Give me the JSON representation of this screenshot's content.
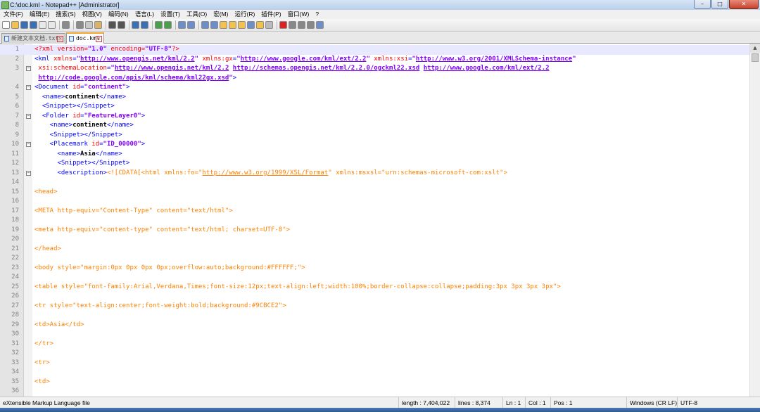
{
  "window": {
    "title": "C:\\doc.kml - Notepad++ [Administrator]",
    "min": "–",
    "max": "□",
    "close": "✕"
  },
  "menu": [
    "文件(F)",
    "编辑(E)",
    "搜索(S)",
    "视图(V)",
    "编码(N)",
    "语言(L)",
    "设置(T)",
    "工具(O)",
    "宏(M)",
    "运行(R)",
    "插件(P)",
    "窗口(W)",
    "?"
  ],
  "toolbar_icons": [
    "new-file-icon",
    "open-file-icon",
    "save-icon",
    "save-all-icon",
    "close-icon",
    "close-all-icon",
    "print-icon",
    "cut-icon",
    "copy-icon",
    "paste-icon",
    "undo-icon",
    "redo-icon",
    "find-icon",
    "replace-icon",
    "zoom-in-icon",
    "zoom-out-icon",
    "sync-vertical-icon",
    "sync-horizontal-icon",
    "word-wrap-icon",
    "show-all-chars-icon",
    "indent-guide-icon",
    "user-lang-icon",
    "doc-map-icon",
    "function-list-icon",
    "folder-workspace-icon",
    "monitoring-icon",
    "record-macro-icon",
    "stop-macro-icon",
    "play-macro-icon",
    "run-macro-icon",
    "save-macro-icon"
  ],
  "tabs": [
    {
      "label": "新建文本文档.txt",
      "active": false
    },
    {
      "label": "doc.kml",
      "active": true
    }
  ],
  "colors": {
    "tag": "#0000ff",
    "attr": "#ff0000",
    "string": "#8000ff",
    "cdata": "#ff8000",
    "accent": "#f3a52d"
  },
  "editor_lines": [
    {
      "n": "1",
      "fold": "",
      "tokens": [
        [
          "t-pi",
          "<?xml "
        ],
        [
          "t-attr",
          "version"
        ],
        [
          "t-pi",
          "="
        ],
        [
          "t-str",
          "\"1.0\""
        ],
        [
          "t-pi",
          " "
        ],
        [
          "t-attr",
          "encoding"
        ],
        [
          "t-pi",
          "="
        ],
        [
          "t-str",
          "\"UTF-8\""
        ],
        [
          "t-pi",
          "?>"
        ]
      ],
      "current": true
    },
    {
      "n": "2",
      "fold": "",
      "tokens": [
        [
          "t-tag",
          "<kml "
        ],
        [
          "t-attr",
          "xmlns"
        ],
        [
          "t-tag",
          "="
        ],
        [
          "t-str",
          "\""
        ],
        [
          "t-url",
          "http://www.opengis.net/kml/2.2"
        ],
        [
          "t-str",
          "\""
        ],
        [
          "t-tag",
          " "
        ],
        [
          "t-attr",
          "xmlns:gx"
        ],
        [
          "t-tag",
          "="
        ],
        [
          "t-str",
          "\""
        ],
        [
          "t-url",
          "http://www.google.com/kml/ext/2.2"
        ],
        [
          "t-str",
          "\""
        ],
        [
          "t-tag",
          " "
        ],
        [
          "t-attr",
          "xmlns:xsi"
        ],
        [
          "t-tag",
          "="
        ],
        [
          "t-str",
          "\""
        ],
        [
          "t-url",
          "http://www.w3.org/2001/XMLSchema-instance"
        ],
        [
          "t-str",
          "\""
        ]
      ]
    },
    {
      "n": "3",
      "fold": "−",
      "tokens": [
        [
          "t-tag",
          " "
        ],
        [
          "t-attr",
          "xsi:schemaLocation"
        ],
        [
          "t-tag",
          "="
        ],
        [
          "t-str",
          "\""
        ],
        [
          "t-url",
          "http://www.opengis.net/kml/2.2"
        ],
        [
          "t-str",
          " "
        ],
        [
          "t-url",
          "http://schemas.opengis.net/kml/2.2.0/ogckml22.xsd"
        ],
        [
          "t-str",
          " "
        ],
        [
          "t-url",
          "http://www.google.com/kml/ext/2.2"
        ]
      ]
    },
    {
      "n": "",
      "fold": "",
      "tokens": [
        [
          "t-str",
          " "
        ],
        [
          "t-url",
          "http://code.google.com/apis/kml/schema/kml22gx.xsd"
        ],
        [
          "t-str",
          "\""
        ],
        [
          "t-tag",
          ">"
        ]
      ]
    },
    {
      "n": "4",
      "fold": "−",
      "tokens": [
        [
          "t-tag",
          "<Document "
        ],
        [
          "t-attr",
          "id"
        ],
        [
          "t-tag",
          "="
        ],
        [
          "t-str",
          "\"continent\""
        ],
        [
          "t-tag",
          ">"
        ]
      ]
    },
    {
      "n": "5",
      "fold": "",
      "tokens": [
        [
          "t-tag",
          "  <name>"
        ],
        [
          "t-text",
          "continent"
        ],
        [
          "t-tag",
          "</name>"
        ]
      ]
    },
    {
      "n": "6",
      "fold": "",
      "tokens": [
        [
          "t-tag",
          "  <Snippet></Snippet>"
        ]
      ]
    },
    {
      "n": "7",
      "fold": "−",
      "tokens": [
        [
          "t-tag",
          "  <Folder "
        ],
        [
          "t-attr",
          "id"
        ],
        [
          "t-tag",
          "="
        ],
        [
          "t-str",
          "\"FeatureLayer0\""
        ],
        [
          "t-tag",
          ">"
        ]
      ]
    },
    {
      "n": "8",
      "fold": "",
      "tokens": [
        [
          "t-tag",
          "    <name>"
        ],
        [
          "t-text",
          "continent"
        ],
        [
          "t-tag",
          "</name>"
        ]
      ]
    },
    {
      "n": "9",
      "fold": "",
      "tokens": [
        [
          "t-tag",
          "    <Snippet></Snippet>"
        ]
      ]
    },
    {
      "n": "10",
      "fold": "−",
      "tokens": [
        [
          "t-tag",
          "    <Placemark "
        ],
        [
          "t-attr",
          "id"
        ],
        [
          "t-tag",
          "="
        ],
        [
          "t-str",
          "\"ID_00000\""
        ],
        [
          "t-tag",
          ">"
        ]
      ]
    },
    {
      "n": "11",
      "fold": "",
      "tokens": [
        [
          "t-tag",
          "      <name>"
        ],
        [
          "t-text",
          "Asia"
        ],
        [
          "t-tag",
          "</name>"
        ]
      ]
    },
    {
      "n": "12",
      "fold": "",
      "tokens": [
        [
          "t-tag",
          "      <Snippet></Snippet>"
        ]
      ]
    },
    {
      "n": "13",
      "fold": "−",
      "tokens": [
        [
          "t-tag",
          "      <description>"
        ],
        [
          "t-cdata",
          "<![CDATA[<html xmlns:fo=\""
        ],
        [
          "t-cdata-url",
          "http://www.w3.org/1999/XSL/Format"
        ],
        [
          "t-cdata",
          "\" xmlns:msxsl=\"urn:schemas-microsoft-com:xslt\">"
        ]
      ]
    },
    {
      "n": "14",
      "fold": "",
      "tokens": []
    },
    {
      "n": "15",
      "fold": "",
      "tokens": [
        [
          "t-cdata",
          "<head>"
        ]
      ]
    },
    {
      "n": "16",
      "fold": "",
      "tokens": []
    },
    {
      "n": "17",
      "fold": "",
      "tokens": [
        [
          "t-cdata",
          "<META http-equiv=\"Content-Type\" content=\"text/html\">"
        ]
      ]
    },
    {
      "n": "18",
      "fold": "",
      "tokens": []
    },
    {
      "n": "19",
      "fold": "",
      "tokens": [
        [
          "t-cdata",
          "<meta http-equiv=\"content-type\" content=\"text/html; charset=UTF-8\">"
        ]
      ]
    },
    {
      "n": "20",
      "fold": "",
      "tokens": []
    },
    {
      "n": "21",
      "fold": "",
      "tokens": [
        [
          "t-cdata",
          "</head>"
        ]
      ]
    },
    {
      "n": "22",
      "fold": "",
      "tokens": []
    },
    {
      "n": "23",
      "fold": "",
      "tokens": [
        [
          "t-cdata",
          "<body style=\"margin:0px 0px 0px 0px;overflow:auto;background:#FFFFFF;\">"
        ]
      ]
    },
    {
      "n": "24",
      "fold": "",
      "tokens": []
    },
    {
      "n": "25",
      "fold": "",
      "tokens": [
        [
          "t-cdata",
          "<table style=\"font-family:Arial,Verdana,Times;font-size:12px;text-align:left;width:100%;border-collapse:collapse;padding:3px 3px 3px 3px\">"
        ]
      ]
    },
    {
      "n": "26",
      "fold": "",
      "tokens": []
    },
    {
      "n": "27",
      "fold": "",
      "tokens": [
        [
          "t-cdata",
          "<tr style=\"text-align:center;font-weight:bold;background:#9CBCE2\">"
        ]
      ]
    },
    {
      "n": "28",
      "fold": "",
      "tokens": []
    },
    {
      "n": "29",
      "fold": "",
      "tokens": [
        [
          "t-cdata",
          "<td>Asia</td>"
        ]
      ]
    },
    {
      "n": "30",
      "fold": "",
      "tokens": []
    },
    {
      "n": "31",
      "fold": "",
      "tokens": [
        [
          "t-cdata",
          "</tr>"
        ]
      ]
    },
    {
      "n": "32",
      "fold": "",
      "tokens": []
    },
    {
      "n": "33",
      "fold": "",
      "tokens": [
        [
          "t-cdata",
          "<tr>"
        ]
      ]
    },
    {
      "n": "34",
      "fold": "",
      "tokens": []
    },
    {
      "n": "35",
      "fold": "",
      "tokens": [
        [
          "t-cdata",
          "<td>"
        ]
      ]
    },
    {
      "n": "36",
      "fold": "",
      "tokens": []
    }
  ],
  "status": {
    "language": "eXtensible Markup Language file",
    "length": "length : 7,404,022",
    "lines": "lines : 8,374",
    "ln": "Ln : 1",
    "col": "Col : 1",
    "pos": "Pos : 1",
    "eol": "Windows (CR LF)",
    "encoding": "UTF-8"
  }
}
